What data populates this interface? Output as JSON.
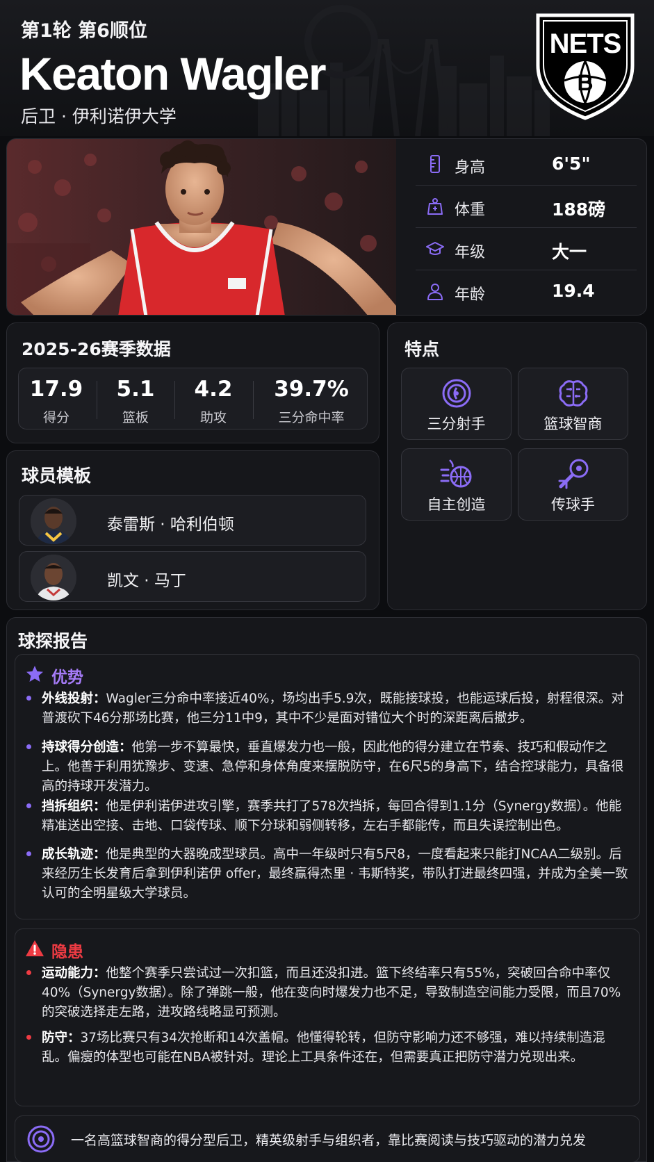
{
  "header": {
    "draft": "第1轮 第6顺位",
    "player_name": "Keaton Wagler",
    "position_school": "后卫 · 伊利诺伊大学",
    "team_logo_text": "NETS"
  },
  "vitals": [
    {
      "icon": "ruler-icon",
      "label": "身高",
      "value": "6'5\""
    },
    {
      "icon": "weight-icon",
      "label": "体重",
      "value": "188磅"
    },
    {
      "icon": "graduation-cap-icon",
      "label": "年级",
      "value": "大一"
    },
    {
      "icon": "person-icon",
      "label": "年龄",
      "value": "19.4"
    }
  ],
  "stats": {
    "title": "2025-26赛季数据",
    "items": [
      {
        "value": "17.9",
        "label": "得分"
      },
      {
        "value": "5.1",
        "label": "篮板"
      },
      {
        "value": "4.2",
        "label": "助攻"
      },
      {
        "value": "39.7%",
        "label": "三分命中率"
      }
    ]
  },
  "traits": {
    "title": "特点",
    "items": [
      {
        "icon": "target-icon",
        "label": "三分射手"
      },
      {
        "icon": "brain-icon",
        "label": "篮球智商"
      },
      {
        "icon": "dribble-basketball-icon",
        "label": "自主创造"
      },
      {
        "icon": "pass-icon",
        "label": "传球手"
      }
    ]
  },
  "templates": {
    "title": "球员模板",
    "items": [
      {
        "name": "泰雷斯 · 哈利伯顿"
      },
      {
        "name": "凯文 · 马丁"
      }
    ]
  },
  "report": {
    "title": "球探报告",
    "strengths": {
      "heading": "优势",
      "items": [
        {
          "label": "外线投射：",
          "text": "Wagler三分命中率接近40%，场均出手5.9次，既能接球投，也能运球后投，射程很深。对普渡砍下46分那场比赛，他三分11中9，其中不少是面对错位大个时的深距离后撤步。"
        },
        {
          "label": "持球得分创造：",
          "text": "他第一步不算最快，垂直爆发力也一般，因此他的得分建立在节奏、技巧和假动作之上。他善于利用犹豫步、变速、急停和身体角度来摆脱防守，在6尺5的身高下，结合控球能力，具备很高的持球开发潜力。"
        },
        {
          "label": "挡拆组织：",
          "text": "他是伊利诺伊进攻引擎，赛季共打了578次挡拆，每回合得到1.1分（Synergy数据）。他能精准送出空接、击地、口袋传球、顺下分球和弱侧转移，左右手都能传，而且失误控制出色。"
        },
        {
          "label": "成长轨迹：",
          "text": "他是典型的大器晚成型球员。高中一年级时只有5尺8，一度看起来只能打NCAA二级别。后来经历生长发育后拿到伊利诺伊 offer，最终赢得杰里 · 韦斯特奖，带队打进最终四强，并成为全美一致认可的全明星级大学球员。"
        }
      ]
    },
    "concerns": {
      "heading": "隐患",
      "items": [
        {
          "label": "运动能力：",
          "text": "他整个赛季只尝试过一次扣篮，而且还没扣进。篮下终结率只有55%，突破回合命中率仅40%（Synergy数据）。除了弹跳一般，他在变向时爆发力也不足，导致制造空间能力受限，而且70%的突破选择走左路，进攻路线略显可预测。"
        },
        {
          "label": "防守：",
          "text": "37场比赛只有34次抢断和14次盖帽。他懂得轮转，但防守影响力还不够强，难以持续制造混乱。偏瘦的体型也可能在NBA被针对。理论上工具条件还在，但需要真正把防守潜力兑现出来。"
        }
      ]
    },
    "summary": "一名高篮球智商的得分型后卫，精英级射手与组织者，靠比赛阅读与技巧驱动的潜力兑发"
  },
  "colors": {
    "accent": "#8b6cf6",
    "strength": "#a57bf7",
    "concern": "#ee3b43",
    "jersey": "#d8282c"
  }
}
